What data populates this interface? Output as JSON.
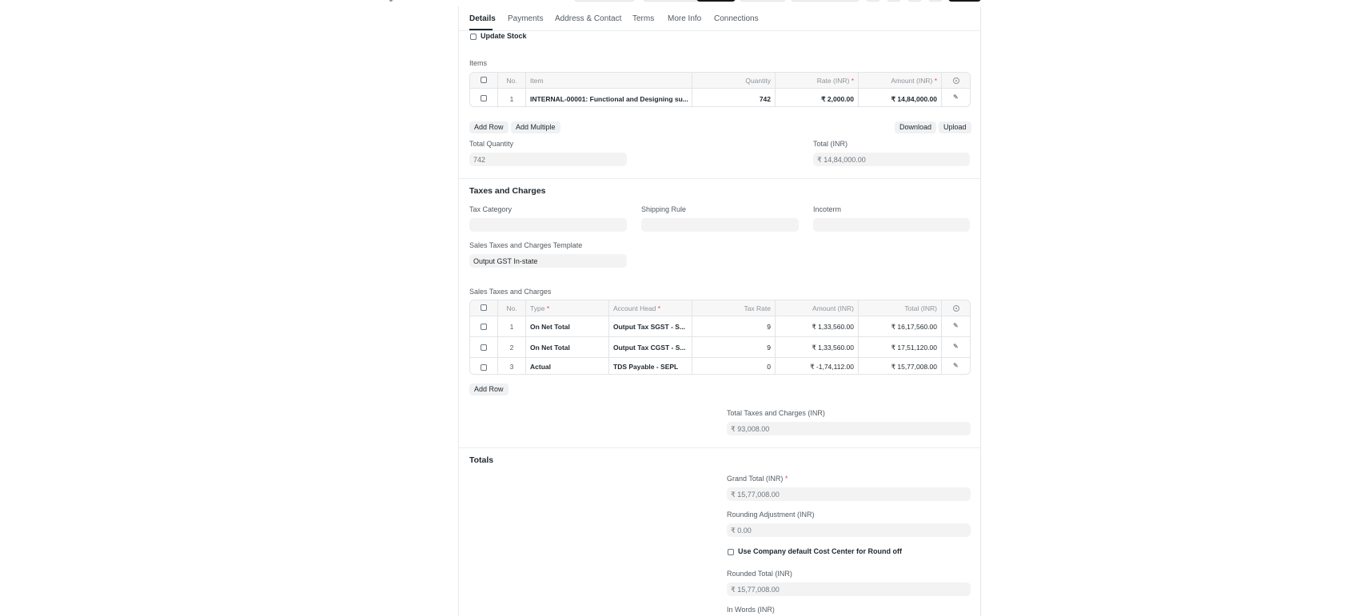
{
  "tabs": [
    {
      "label": "Details"
    },
    {
      "label": "Payments"
    },
    {
      "label": "Address & Contact"
    },
    {
      "label": "Terms"
    },
    {
      "label": "More Info"
    },
    {
      "label": "Connections"
    }
  ],
  "update_stock_label": "Update Stock",
  "items": {
    "label": "Items",
    "headers": {
      "no": "No.",
      "item": "Item",
      "quantity": "Quantity",
      "rate": "Rate (INR)",
      "amount": "Amount (INR)"
    },
    "required_mark": "*",
    "rows": [
      {
        "no": "1",
        "item": "INTERNAL-00001: Functional and Designing su...",
        "quantity": "742",
        "rate": "₹ 2,000.00",
        "amount": "₹ 14,84,000.00"
      }
    ],
    "add_row": "Add Row",
    "add_multiple": "Add Multiple",
    "download": "Download",
    "upload": "Upload"
  },
  "total_quantity": {
    "label": "Total Quantity",
    "value": "742"
  },
  "total": {
    "label": "Total (INR)",
    "value": "₹ 14,84,000.00"
  },
  "taxes_section": {
    "title": "Taxes and Charges",
    "tax_category": {
      "label": "Tax Category",
      "value": ""
    },
    "shipping_rule": {
      "label": "Shipping Rule",
      "value": ""
    },
    "incoterm": {
      "label": "Incoterm",
      "value": ""
    },
    "template": {
      "label": "Sales Taxes and Charges Template",
      "value": "Output GST In-state"
    },
    "grid_label": "Sales Taxes and Charges",
    "headers": {
      "no": "No.",
      "type": "Type",
      "account_head": "Account Head",
      "tax_rate": "Tax Rate",
      "amount": "Amount (INR)",
      "total": "Total (INR)"
    },
    "rows": [
      {
        "no": "1",
        "type": "On Net Total",
        "account_head": "Output Tax SGST - S...",
        "tax_rate": "9",
        "amount": "₹ 1,33,560.00",
        "total": "₹ 16,17,560.00"
      },
      {
        "no": "2",
        "type": "On Net Total",
        "account_head": "Output Tax CGST - S...",
        "tax_rate": "9",
        "amount": "₹ 1,33,560.00",
        "total": "₹ 17,51,120.00"
      },
      {
        "no": "3",
        "type": "Actual",
        "account_head": "TDS Payable - SEPL",
        "tax_rate": "0",
        "amount": "₹ -1,74,112.00",
        "total": "₹ 15,77,008.00"
      }
    ],
    "add_row": "Add Row",
    "total_taxes": {
      "label": "Total Taxes and Charges (INR)",
      "value": "₹ 93,008.00"
    }
  },
  "totals_section": {
    "title": "Totals",
    "grand_total": {
      "label": "Grand Total (INR)",
      "value": "₹ 15,77,008.00"
    },
    "rounding_adjustment": {
      "label": "Rounding Adjustment (INR)",
      "value": "₹ 0.00"
    },
    "use_default_cost_center": "Use Company default Cost Center for Round off",
    "rounded_total": {
      "label": "Rounded Total (INR)",
      "value": "₹ 15,77,008.00"
    },
    "in_words": {
      "label": "In Words (INR)",
      "value": ""
    }
  }
}
